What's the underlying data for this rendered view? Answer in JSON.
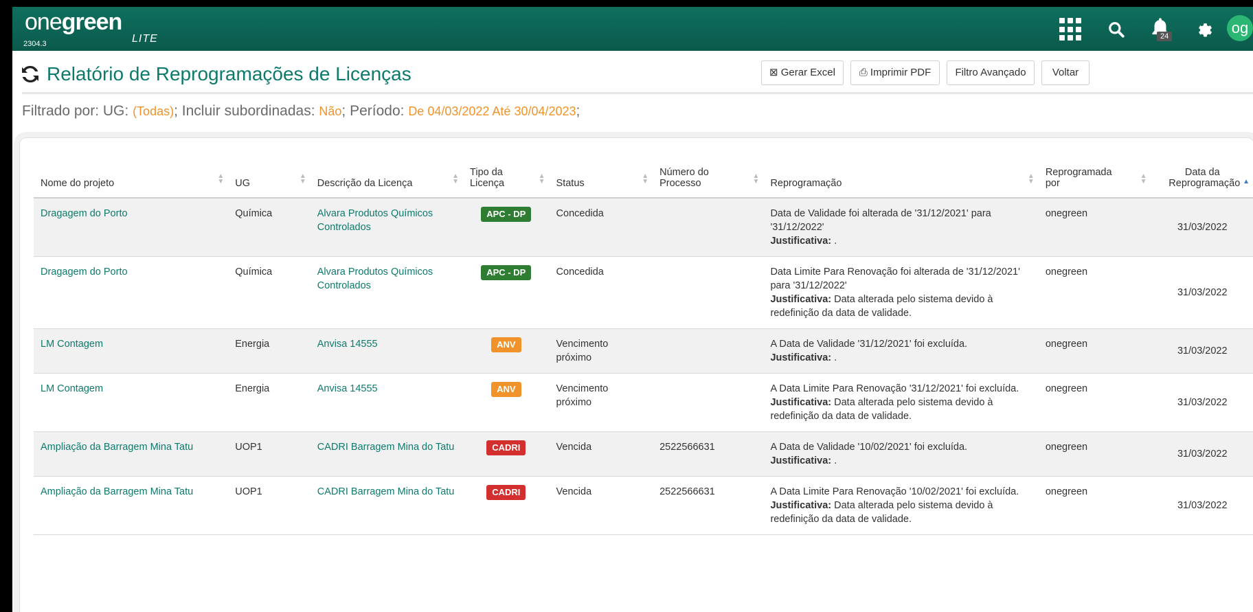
{
  "app": {
    "logo_thin": "one",
    "logo_bold": "green",
    "logo_lite": "LITE",
    "version": "2304.3",
    "notifications_count": "24",
    "avatar_initials": "og"
  },
  "page": {
    "title": "Relatório de Reprogramações de Licenças"
  },
  "toolbar": {
    "excel_label": "Gerar Excel",
    "pdf_label": "Imprimir PDF",
    "filtro_label": "Filtro Avançado",
    "voltar_label": "Voltar"
  },
  "filter": {
    "prefix": "Filtrado por: UG: ",
    "ug_value": "(Todas)",
    "sub_label": "; Incluir subordinadas: ",
    "sub_value": "Não",
    "periodo_label": "; Período: ",
    "periodo_value": "De 04/03/2022 Até 30/04/2023",
    "suffix": ";"
  },
  "table": {
    "headers": {
      "nome": "Nome do projeto",
      "ug": "UG",
      "descricao": "Descrição da Licença",
      "tipo": "Tipo da Licença",
      "status": "Status",
      "processo": "Número do Processo",
      "reprogramacao": "Reprogramação",
      "por": "Reprogramada por",
      "data": "Data da Reprogramação"
    },
    "justificativa_label": "Justificativa:",
    "rows": [
      {
        "nome": "Dragagem do Porto",
        "ug": "Química",
        "descricao": "Alvara Produtos Químicos Controlados",
        "tipo": "APC - DP",
        "status": "Concedida",
        "processo": "",
        "reprog": "Data de Validade foi alterada de '31/12/2021' para '31/12/2022'",
        "just": ".",
        "por": "onegreen",
        "data": "31/03/2022"
      },
      {
        "nome": "Dragagem do Porto",
        "ug": "Química",
        "descricao": "Alvara Produtos Químicos Controlados",
        "tipo": "APC - DP",
        "status": "Concedida",
        "processo": "",
        "reprog": "Data Limite Para Renovação foi alterada de '31/12/2021' para '31/12/2022'",
        "just": "Data alterada pelo sistema devido à redefinição da data de validade.",
        "por": "onegreen",
        "data": "31/03/2022"
      },
      {
        "nome": "LM Contagem",
        "ug": "Energia",
        "descricao": "Anvisa 14555",
        "tipo": "ANV",
        "status": "Vencimento próximo",
        "processo": "",
        "reprog": "A Data de Validade '31/12/2021' foi excluída.",
        "just": ".",
        "por": "onegreen",
        "data": "31/03/2022"
      },
      {
        "nome": "LM Contagem",
        "ug": "Energia",
        "descricao": "Anvisa 14555",
        "tipo": "ANV",
        "status": "Vencimento próximo",
        "processo": "",
        "reprog": "A Data Limite Para Renovação '31/12/2021' foi excluída.",
        "just": "Data alterada pelo sistema devido à redefinição da data de validade.",
        "por": "onegreen",
        "data": "31/03/2022"
      },
      {
        "nome": "Ampliação da Barragem Mina Tatu",
        "ug": "UOP1",
        "descricao": "CADRI Barragem Mina do Tatu",
        "tipo": "CADRI",
        "status": "Vencida",
        "processo": "2522566631",
        "reprog": "A Data de Validade '10/02/2021' foi excluída.",
        "just": ".",
        "por": "onegreen",
        "data": "31/03/2022"
      },
      {
        "nome": "Ampliação da Barragem Mina Tatu",
        "ug": "UOP1",
        "descricao": "CADRI Barragem Mina do Tatu",
        "tipo": "CADRI",
        "status": "Vencida",
        "processo": "2522566631",
        "reprog": "A Data Limite Para Renovação '10/02/2021' foi excluída.",
        "just": "Data alterada pelo sistema devido à redefinição da data de validade.",
        "por": "onegreen",
        "data": "31/03/2022"
      }
    ]
  },
  "colors": {
    "header_bg": "#0b5a4c",
    "accent": "#0e7a6c",
    "filter_value": "#f0932b",
    "tag_green": "#2e7d32",
    "tag_orange": "#f0932b",
    "tag_red": "#d32f2f"
  },
  "icons": [
    "apps-grid-icon",
    "search-icon",
    "bell-icon",
    "gear-icon",
    "refresh-icon",
    "excel-icon",
    "printer-icon",
    "sort-icon"
  ]
}
